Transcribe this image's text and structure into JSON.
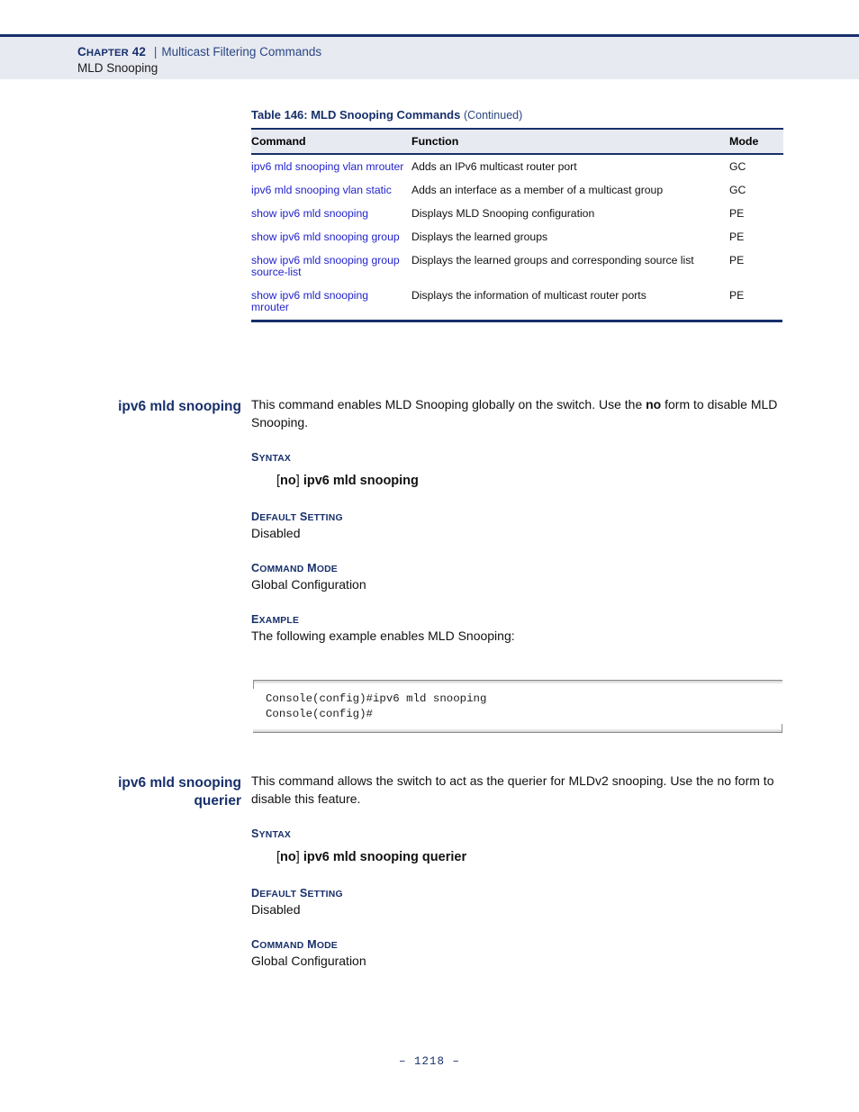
{
  "header": {
    "chapter_label": "Chapter 42",
    "separator": "|",
    "subject": "Multicast Filtering Commands",
    "section": "MLD Snooping"
  },
  "table": {
    "caption": "Table 146: MLD Snooping Commands",
    "caption_suffix": "(Continued)",
    "columns": [
      "Command",
      "Function",
      "Mode"
    ],
    "rows": [
      {
        "command": "ipv6 mld snooping vlan mrouter",
        "function": "Adds an IPv6 multicast router port",
        "mode": "GC"
      },
      {
        "command": "ipv6 mld snooping vlan static",
        "function": "Adds an interface as a member of a multicast group",
        "mode": "GC"
      },
      {
        "command": "show ipv6 mld snooping",
        "function": "Displays MLD Snooping configuration",
        "mode": "PE"
      },
      {
        "command": "show ipv6 mld snooping group",
        "function": "Displays the learned groups",
        "mode": "PE"
      },
      {
        "command": "show ipv6 mld snooping group source-list",
        "function": "Displays the learned groups and corresponding source list",
        "mode": "PE"
      },
      {
        "command": "show ipv6 mld snooping mrouter",
        "function": "Displays the information of multicast router ports",
        "mode": "PE"
      }
    ]
  },
  "sections": [
    {
      "heading": "ipv6 mld snooping",
      "description_part1": "This command enables MLD Snooping globally on the switch. Use the ",
      "description_bold": "no",
      "description_part2": " form to disable MLD Snooping.",
      "syntax_label": "Syntax",
      "syntax_open": "[",
      "syntax_no": "no",
      "syntax_close": "] ",
      "syntax_command": "ipv6 mld snooping",
      "default_label": "Default Setting",
      "default_value": "Disabled",
      "mode_label": "Command Mode",
      "mode_value": "Global Configuration",
      "example_label": "Example",
      "example_text": "The following example enables MLD Snooping:",
      "console": "Console(config)#ipv6 mld snooping\nConsole(config)#"
    },
    {
      "heading_line1": "ipv6 mld snooping",
      "heading_line2": "querier",
      "description": "This command allows the switch to act as the querier for MLDv2 snooping. Use the no form to disable this feature.",
      "syntax_label": "Syntax",
      "syntax_open": "[",
      "syntax_no": "no",
      "syntax_close": "] ",
      "syntax_command": "ipv6 mld snooping querier",
      "default_label": "Default Setting",
      "default_value": "Disabled",
      "mode_label": "Command Mode",
      "mode_value": "Global Configuration"
    }
  ],
  "footer": {
    "page_number": "–  1218  –"
  },
  "colors": {
    "navy": "#17306b",
    "link_blue": "#2323cc",
    "header_band": "#e7eaf1"
  }
}
